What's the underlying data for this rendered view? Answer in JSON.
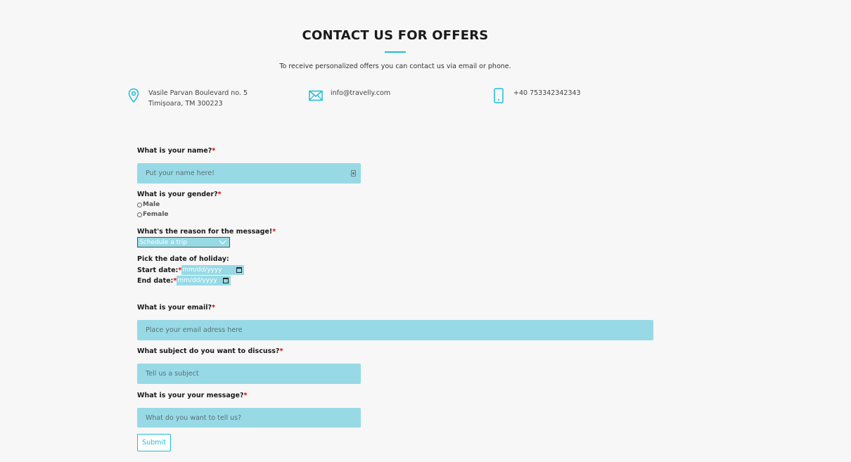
{
  "header": {
    "title": "CONTACT US FOR OFFERS",
    "subtitle": "To receive personalized offers you can contact us via email or phone."
  },
  "contact": {
    "address_line1": "Vasile Parvan Boulevard no. 5",
    "address_line2": "Timișoara, TM 300223",
    "email": "info@travelly.com",
    "phone": "+40 753342342343",
    "accent_color": "#1ebdd8"
  },
  "form": {
    "name_label": "What is your name?",
    "name_placeholder": "Put your name here!",
    "gender_label": "What is your gender?",
    "gender_options": [
      "Male",
      "Female"
    ],
    "reason_label": "What's the reason for the message!",
    "reason_selected": "Schedule a trip",
    "holiday_label": "Pick the date of holiday:",
    "start_label": "Start date:",
    "start_value": "mm/dd/yyyy",
    "end_label": "End date:",
    "end_value": "mm/dd/yyyy",
    "email_label": "What is your email?",
    "email_placeholder": "Place your email adress here",
    "subject_label": "What subject do you want to discuss?",
    "subject_placeholder": "Tell us a subject",
    "message_label": "What is your your message?",
    "message_placeholder": "What do you want to tell us?",
    "required_mark": "*",
    "submit_label": "Submit",
    "field_color": "#97dae6"
  }
}
